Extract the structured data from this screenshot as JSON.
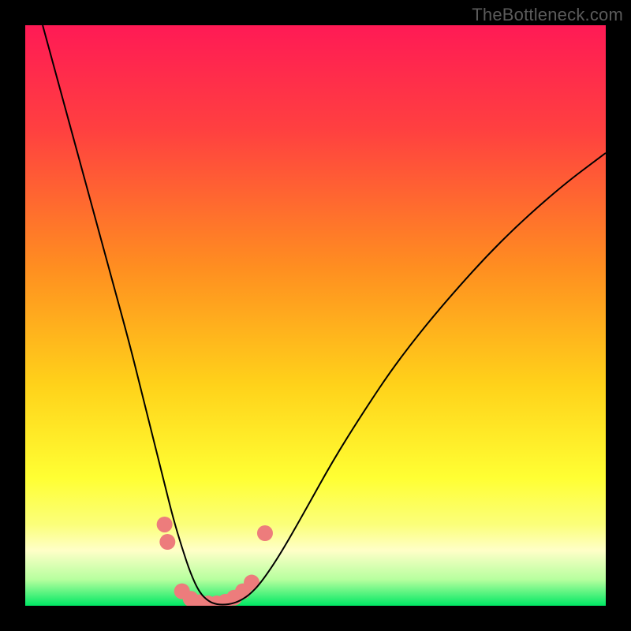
{
  "watermark": "TheBottleneck.com",
  "chart_data": {
    "type": "line",
    "title": "",
    "xlabel": "",
    "ylabel": "",
    "xlim": [
      0,
      100
    ],
    "ylim": [
      0,
      100
    ],
    "grid": false,
    "legend": false,
    "background_gradient": {
      "stops": [
        {
          "offset": 0.0,
          "color": "#ff1a55"
        },
        {
          "offset": 0.18,
          "color": "#ff4040"
        },
        {
          "offset": 0.42,
          "color": "#ff8f20"
        },
        {
          "offset": 0.62,
          "color": "#ffd21a"
        },
        {
          "offset": 0.78,
          "color": "#ffff33"
        },
        {
          "offset": 0.86,
          "color": "#fbff7a"
        },
        {
          "offset": 0.905,
          "color": "#ffffc8"
        },
        {
          "offset": 0.955,
          "color": "#b6ff9e"
        },
        {
          "offset": 1.0,
          "color": "#00e864"
        }
      ]
    },
    "series": [
      {
        "name": "bottleneck-curve",
        "color": "#000000",
        "stroke_width": 2.0,
        "x": [
          3,
          6,
          9,
          12,
          15,
          18,
          20,
          22,
          24,
          25.5,
          27,
          28.5,
          30,
          31.5,
          33,
          35,
          37,
          39,
          41,
          44,
          48,
          53,
          58,
          64,
          72,
          82,
          92,
          100
        ],
        "y": [
          100,
          89,
          78,
          67,
          56,
          45,
          37,
          29,
          21,
          15,
          10,
          5.5,
          2.3,
          0.8,
          0.2,
          0.2,
          0.8,
          2.2,
          4.5,
          9,
          16,
          25,
          33,
          42,
          52,
          63,
          72,
          78
        ]
      }
    ],
    "markers": {
      "name": "highlight-dots",
      "color": "#ed7c7c",
      "radius": 10,
      "points": [
        {
          "x": 24.0,
          "y": 14.0
        },
        {
          "x": 24.5,
          "y": 11.0
        },
        {
          "x": 27.0,
          "y": 2.5
        },
        {
          "x": 28.5,
          "y": 1.2
        },
        {
          "x": 30.0,
          "y": 0.6
        },
        {
          "x": 31.5,
          "y": 0.4
        },
        {
          "x": 33.0,
          "y": 0.4
        },
        {
          "x": 34.5,
          "y": 0.7
        },
        {
          "x": 36.0,
          "y": 1.4
        },
        {
          "x": 37.5,
          "y": 2.5
        },
        {
          "x": 39.0,
          "y": 4.0
        },
        {
          "x": 41.3,
          "y": 12.5
        }
      ]
    }
  }
}
